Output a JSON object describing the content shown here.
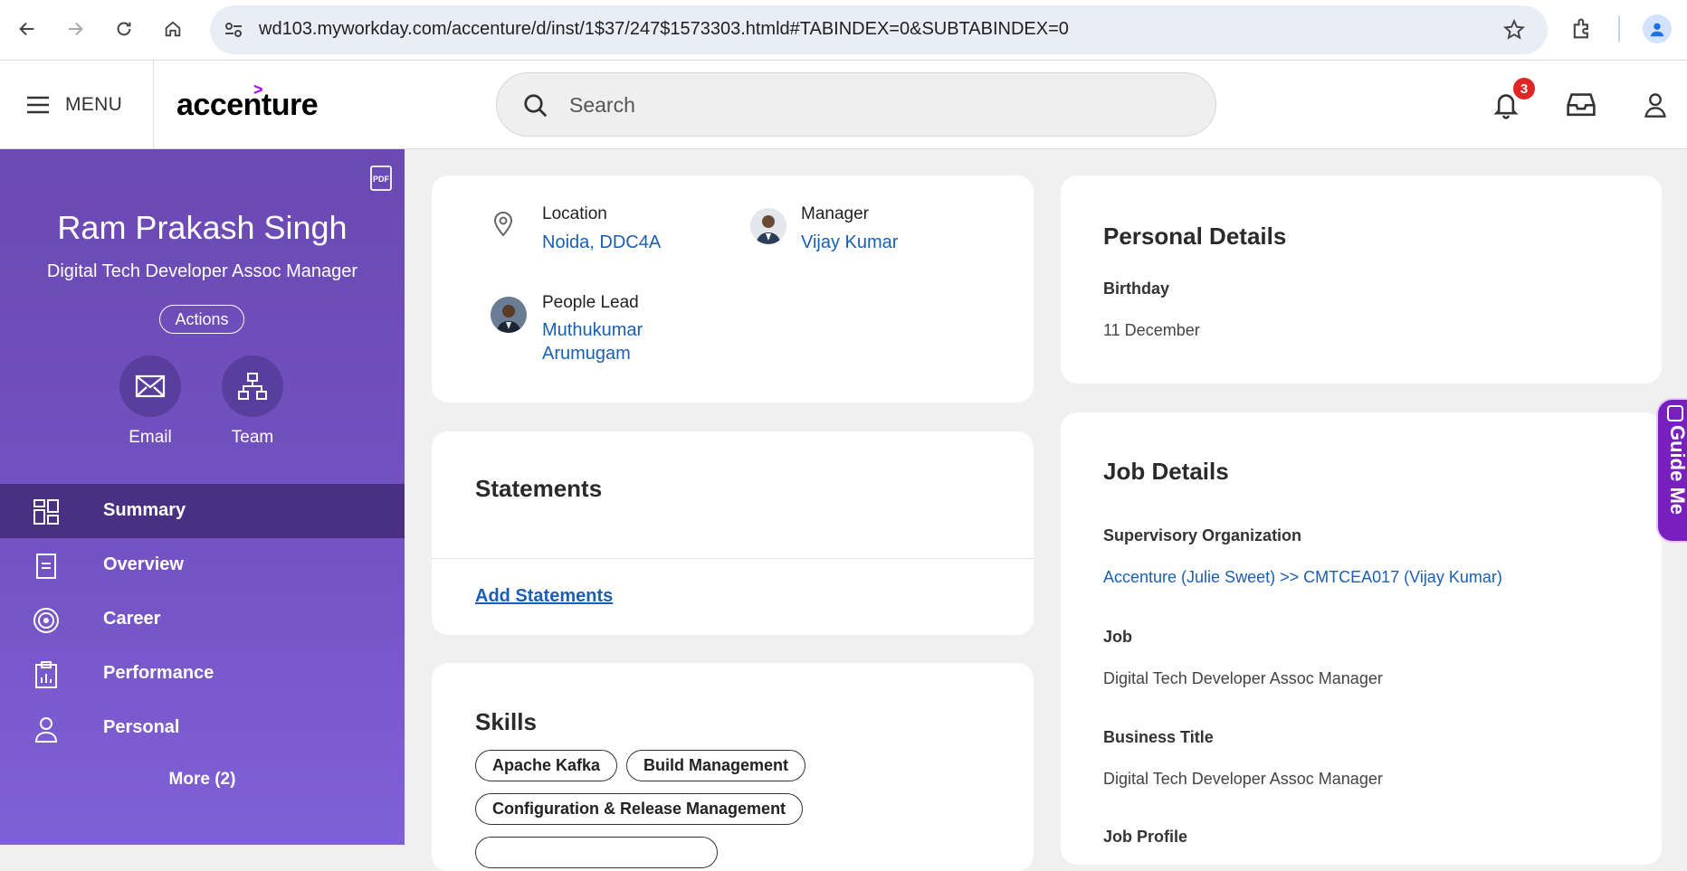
{
  "browser": {
    "url": "wd103.myworkday.com/accenture/d/inst/1$37/247$1573303.htmld#TABINDEX=0&SUBTABINDEX=0"
  },
  "header": {
    "menu_label": "MENU",
    "logo_text": "accenture",
    "search_placeholder": "Search",
    "notification_count": "3"
  },
  "profile": {
    "name": "Ram Prakash Singh",
    "title": "Digital Tech Developer Assoc Manager",
    "actions_label": "Actions",
    "email_label": "Email",
    "team_label": "Team"
  },
  "sidebar": {
    "items": [
      {
        "label": "Summary",
        "icon": "dashboard-icon"
      },
      {
        "label": "Overview",
        "icon": "document-icon"
      },
      {
        "label": "Career",
        "icon": "target-icon"
      },
      {
        "label": "Performance",
        "icon": "clipboard-chart-icon"
      },
      {
        "label": "Personal",
        "icon": "person-icon"
      }
    ],
    "more_label": "More (2)"
  },
  "overview_card": {
    "location_label": "Location",
    "location_value": "Noida, DDC4A",
    "manager_label": "Manager",
    "manager_value": "Vijay Kumar",
    "people_lead_label": "People Lead",
    "people_lead_value_line1": "Muthukumar",
    "people_lead_value_line2": "Arumugam"
  },
  "statements": {
    "title": "Statements",
    "add_link": "Add Statements"
  },
  "skills": {
    "title": "Skills",
    "chips": [
      "Apache Kafka",
      "Build Management",
      "Configuration & Release Management"
    ]
  },
  "personal_details": {
    "title": "Personal Details",
    "birthday_label": "Birthday",
    "birthday_value": "11 December"
  },
  "job_details": {
    "title": "Job Details",
    "supervisory_org_label": "Supervisory Organization",
    "supervisory_org_value": "Accenture (Julie Sweet) >> CMTCEA017 (Vijay Kumar)",
    "job_label": "Job",
    "job_value": "Digital Tech Developer Assoc Manager",
    "business_title_label": "Business Title",
    "business_title_value": "Digital Tech Developer Assoc Manager",
    "job_profile_label": "Job Profile"
  },
  "guide_me": {
    "label": "Guide Me"
  },
  "colors": {
    "sidebar": "#7353c2",
    "sidebar_active": "#4a3083",
    "link": "#1a5fb4",
    "badge": "#de2626",
    "brand_accent": "#a100ff"
  }
}
